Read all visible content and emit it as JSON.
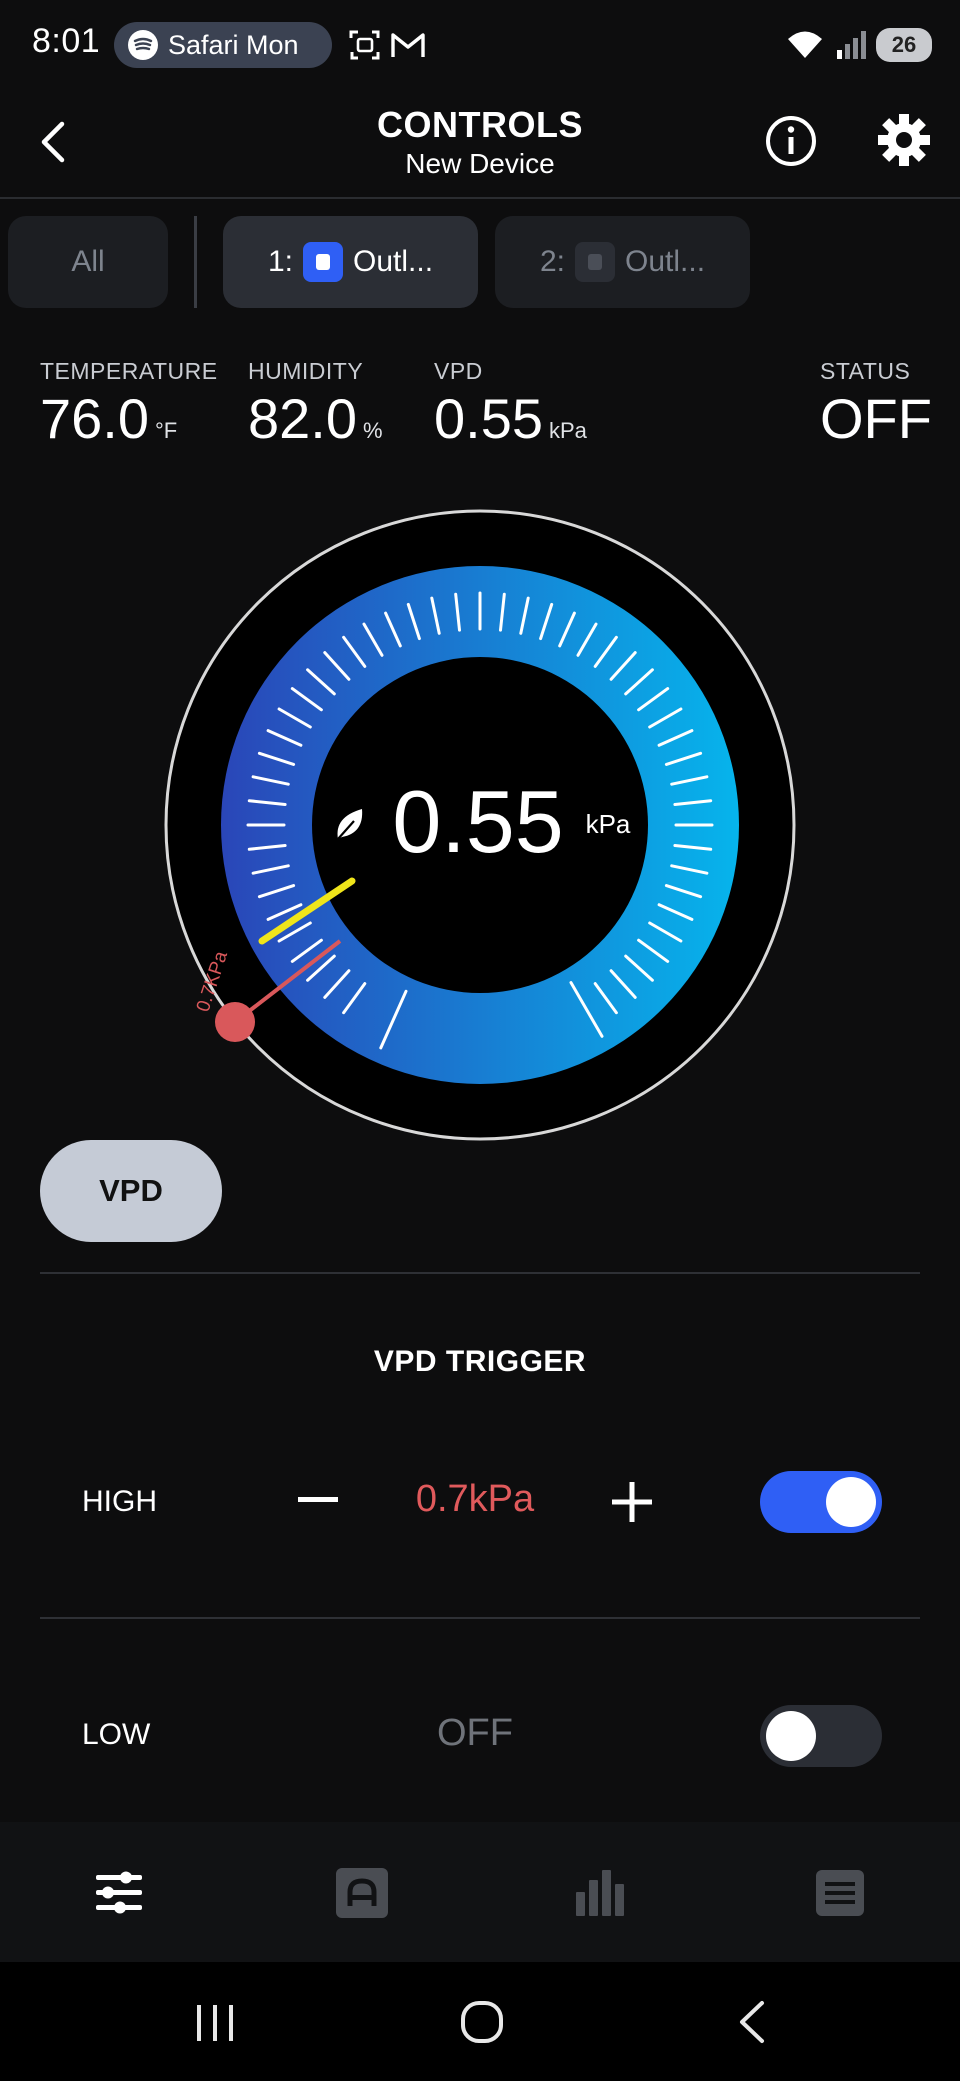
{
  "status_bar": {
    "time": "8:01",
    "media_pill": "Safari Mon",
    "battery": "26",
    "icons": [
      "spotify-icon",
      "screenshot-icon",
      "gmail-icon",
      "wifi-icon",
      "signal-icon",
      "battery-icon"
    ]
  },
  "header": {
    "title": "CONTROLS",
    "subtitle": "New Device",
    "back_icon": "chevron-left-icon",
    "info_icon": "info-icon",
    "settings_icon": "gear-icon"
  },
  "tabs": [
    {
      "label": "All",
      "active": false
    },
    {
      "prefix": "1:",
      "label": "Outl...",
      "active": true,
      "icon": "outlet-icon"
    },
    {
      "prefix": "2:",
      "label": "Outl...",
      "active": false,
      "icon": "outlet-icon"
    }
  ],
  "sensors": {
    "temperature": {
      "label": "TEMPERATURE",
      "value": "76.0",
      "unit": "°F"
    },
    "humidity": {
      "label": "HUMIDITY",
      "value": "82.0",
      "unit": "%"
    },
    "vpd": {
      "label": "VPD",
      "value": "0.55",
      "unit": "kPa"
    },
    "status": {
      "label": "STATUS",
      "value": "OFF"
    }
  },
  "gauge": {
    "value": "0.55",
    "unit": "kPa",
    "marker_label": "0.7KPa",
    "icon": "leaf-icon",
    "colors": {
      "start": "#2a46b8",
      "end": "#06b4ec",
      "marker": "#d9585b",
      "needle": "#f0e51a"
    }
  },
  "mode_button": "VPD",
  "trigger": {
    "title": "VPD TRIGGER",
    "high": {
      "label": "HIGH",
      "value": "0.7kPa",
      "enabled": true,
      "value_color": "#e05a5c"
    },
    "low": {
      "label": "LOW",
      "value": "OFF",
      "enabled": false
    }
  },
  "bottom_nav": [
    {
      "icon": "sliders-icon",
      "active": true
    },
    {
      "icon": "automation-icon",
      "active": false
    },
    {
      "icon": "bar-chart-icon",
      "active": false
    },
    {
      "icon": "list-icon",
      "active": false
    }
  ],
  "system_nav": [
    "recents-icon",
    "home-icon",
    "back-icon"
  ],
  "accent": "#2f5ff5"
}
